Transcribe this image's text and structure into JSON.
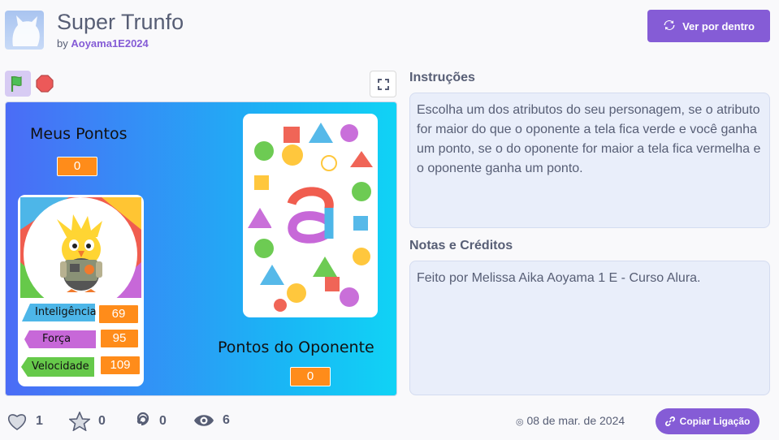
{
  "project": {
    "title": "Super Trunfo",
    "by_prefix": "by",
    "author": "Aoyama1E2024",
    "see_inside_label": "Ver por dentro"
  },
  "stage": {
    "my_points_label": "Meus Pontos",
    "my_points_value": "0",
    "opponent_points_label": "Pontos do Oponente",
    "opponent_points_value": "0",
    "attributes": [
      {
        "name": "Inteligência",
        "value": "69",
        "color": "#4db6e8"
      },
      {
        "name": "Força",
        "value": "95",
        "color": "#c768d8"
      },
      {
        "name": "Velocidade",
        "value": "109",
        "color": "#66c94a"
      }
    ]
  },
  "instructions": {
    "heading": "Instruções",
    "text": "Escolha um dos atributos do seu personagem, se o atributo for maior do que o oponente a tela fica verde e você ganha um ponto, se o do oponente for maior a tela fica vermelha e o oponente ganha um ponto."
  },
  "notes": {
    "heading": "Notas e Créditos",
    "text": "Feito por Melissa Aika Aoyama 1 E - Curso Alura."
  },
  "stats": {
    "loves": "1",
    "favorites": "0",
    "remixes": "0",
    "views": "6"
  },
  "date": "08 de mar. de 2024",
  "copy_link_label": "Copiar Ligação",
  "colors": {
    "accent": "#855cd6",
    "orange": "#ff8c1a",
    "text": "#575e75"
  }
}
